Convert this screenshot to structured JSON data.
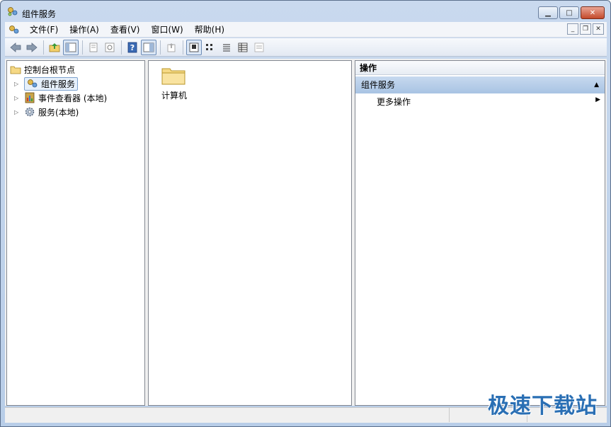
{
  "window": {
    "title": "组件服务",
    "controls": [
      "minimize-icon",
      "maximize-icon",
      "close-icon"
    ]
  },
  "menubar": {
    "items": [
      "文件(F)",
      "操作(A)",
      "查看(V)",
      "窗口(W)",
      "帮助(H)"
    ]
  },
  "toolbar": {
    "buttons": [
      "back-icon",
      "forward-icon",
      "up-folder-icon",
      "show-hide-tree-icon",
      "properties-icon",
      "refresh-icon",
      "help-icon",
      "show-hide-action-pane-icon",
      "export-icon",
      "large-icons-view-icon",
      "small-icons-view-icon",
      "list-view-icon",
      "detail-view-icon",
      "property-view-icon"
    ]
  },
  "tree": {
    "root": "控制台根节点",
    "items": [
      {
        "label": "组件服务",
        "icon": "component-services-icon",
        "selected": true
      },
      {
        "label": "事件查看器 (本地)",
        "icon": "event-viewer-icon",
        "selected": false
      },
      {
        "label": "服务(本地)",
        "icon": "services-gear-icon",
        "selected": false
      }
    ]
  },
  "results": {
    "items": [
      {
        "label": "计算机",
        "icon": "folder-icon"
      }
    ]
  },
  "actions": {
    "header": "操作",
    "section": "组件服务",
    "items": [
      "更多操作"
    ]
  },
  "watermark": "极速下载站",
  "colors": {
    "frame": "#b8cde8",
    "section_header": "#a8c3e3",
    "selection": "#e6f0fb",
    "watermark": "#2a6fb4"
  }
}
